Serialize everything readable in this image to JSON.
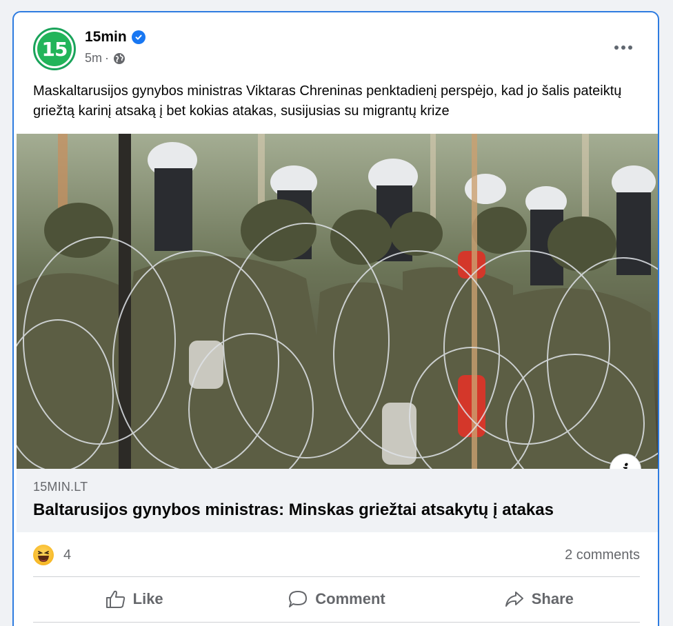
{
  "post": {
    "avatar_text": "15",
    "page_name": "15min",
    "timestamp": "5m",
    "separator": "·",
    "audience_icon": "globe-icon",
    "verified_icon": "verified-badge-icon",
    "more_icon": "more-options-icon",
    "text": "Maskaltarusijos gynybos ministras Viktaras Chreninas penktadienį perspėjo, kad jo šalis pateiktų griežtą karinį atsaką į bet kokias atakas, susijusias su migrantų krize"
  },
  "link_preview": {
    "info_label": "i",
    "domain": "15MIN.LT",
    "title": "Baltarusijos gynybos ministras: Minskas griežtai atsakytų į atakas"
  },
  "engagement": {
    "reaction_icon": "haha-emoji-icon",
    "reaction_count": "4",
    "comments": "2 comments"
  },
  "actions": [
    {
      "label": "Like",
      "icon": "like-thumb-icon"
    },
    {
      "label": "Comment",
      "icon": "comment-bubble-icon"
    },
    {
      "label": "Share",
      "icon": "share-arrow-icon"
    }
  ],
  "colors": {
    "focus_border": "#2d7be0",
    "verified": "#1877f2",
    "avatar_green": "#22b45a",
    "secondary_text": "#65676b"
  }
}
